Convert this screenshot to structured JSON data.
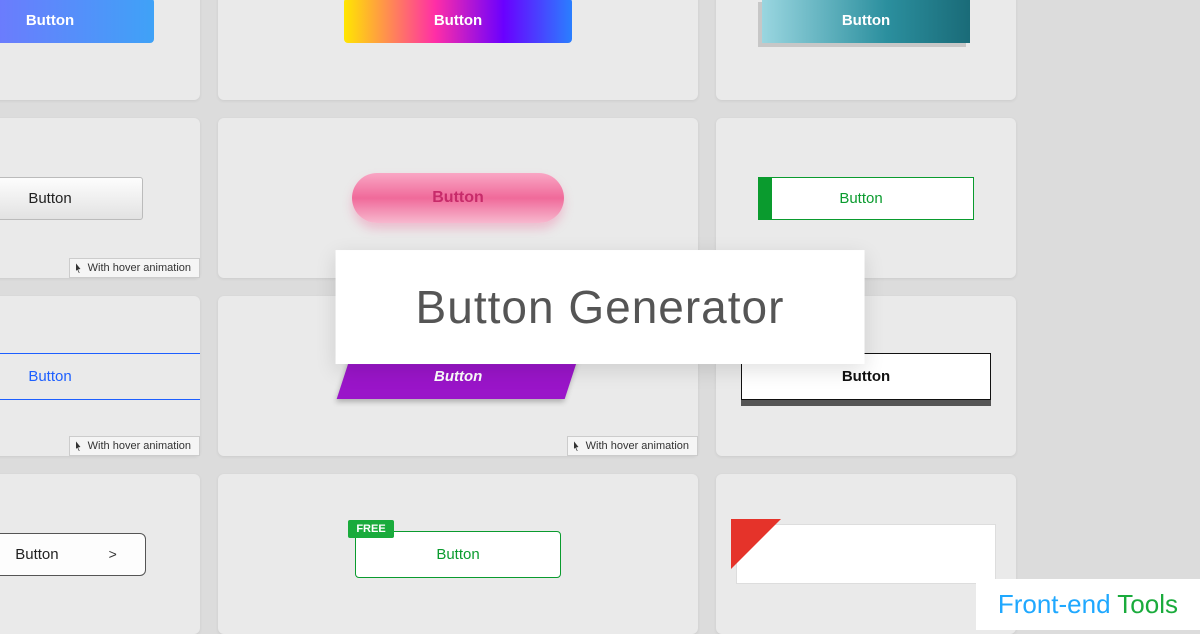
{
  "title": "Button Generator",
  "watermark": {
    "prefix": "Front-end ",
    "suffix": "Tools"
  },
  "hover_label": "With hover animation",
  "cards": {
    "r1c1": {
      "label": "Button"
    },
    "r1c2": {
      "label": "Button"
    },
    "r1c3": {
      "label": "Button"
    },
    "r2c1": {
      "label": "Button",
      "hover": true
    },
    "r2c2": {
      "label": "Button"
    },
    "r2c3": {
      "label": "Button"
    },
    "r3c1": {
      "label": "Button",
      "hover": true
    },
    "r3c2": {
      "label": "Button",
      "hover": true
    },
    "r3c3": {
      "label": "Button"
    },
    "r4c1": {
      "label": "Button"
    },
    "r4c2": {
      "label": "Button",
      "badge": "FREE"
    },
    "r4c3": {
      "label": ""
    }
  }
}
